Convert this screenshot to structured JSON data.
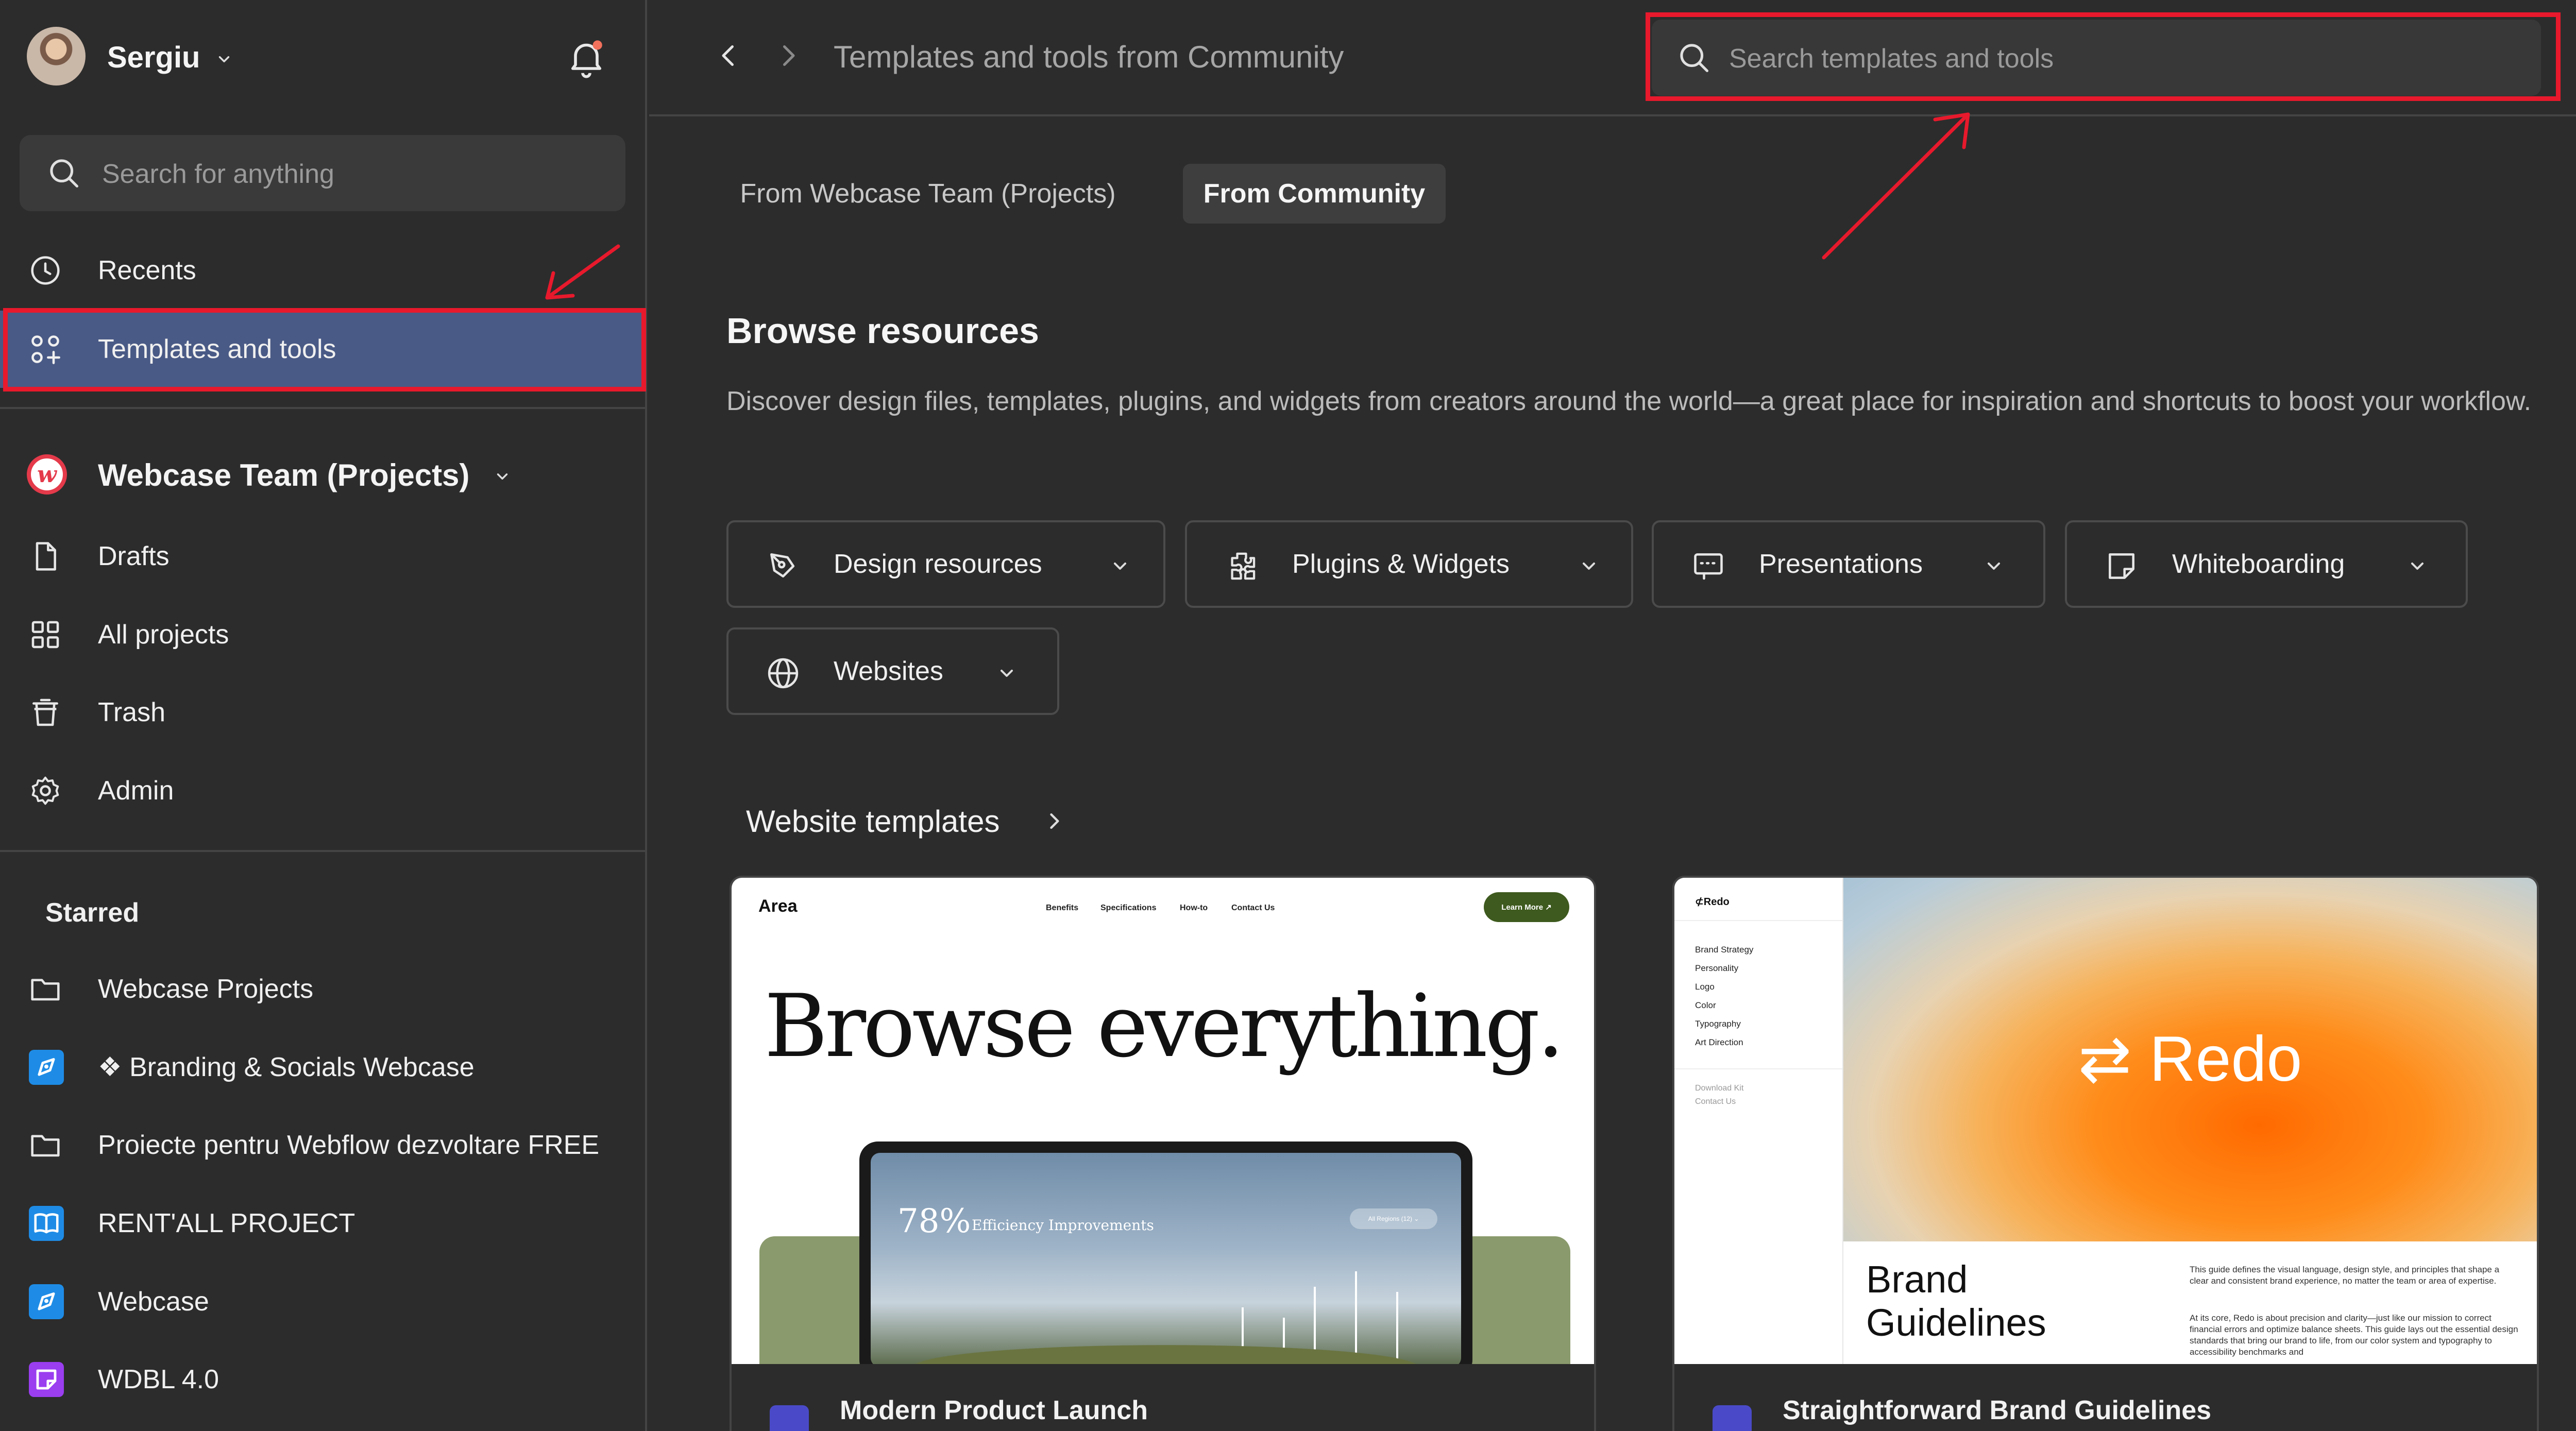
{
  "user": {
    "name": "Sergiu"
  },
  "sidebar": {
    "search_placeholder": "Search for anything",
    "nav": [
      {
        "label": "Recents",
        "icon": "clock-icon"
      },
      {
        "label": "Templates and tools",
        "icon": "templates-icon",
        "active": true
      }
    ],
    "team": {
      "name": "Webcase Team (Projects)"
    },
    "team_items": [
      {
        "label": "Drafts",
        "icon": "file-icon"
      },
      {
        "label": "All projects",
        "icon": "grid-icon"
      },
      {
        "label": "Trash",
        "icon": "trash-icon"
      },
      {
        "label": "Admin",
        "icon": "gear-icon"
      }
    ],
    "starred_heading": "Starred",
    "starred": [
      {
        "label": "Webcase Projects",
        "icon": "folder-icon"
      },
      {
        "label": "❖ Branding & Socials Webcase",
        "icon": "design-file-icon",
        "color": "#1e8ce6"
      },
      {
        "label": "Proiecte pentru Webflow dezvoltare FREE",
        "icon": "folder-icon"
      },
      {
        "label": "RENT'ALL PROJECT",
        "icon": "book-icon",
        "color": "#1e8ce6"
      },
      {
        "label": "Webcase",
        "icon": "design-file-icon",
        "color": "#1e8ce6"
      },
      {
        "label": "WDBL 4.0",
        "icon": "whiteboard-file-icon",
        "color": "#9a3ef0"
      }
    ]
  },
  "header": {
    "title": "Templates and tools from Community",
    "search_placeholder": "Search templates and tools"
  },
  "tabs": [
    {
      "label": "From Webcase Team (Projects)",
      "active": false
    },
    {
      "label": "From Community",
      "active": true
    }
  ],
  "browse": {
    "title": "Browse resources",
    "description": "Discover design files, templates, plugins, and widgets from creators around the world—a great place for inspiration and shortcuts to boost your workflow."
  },
  "categories": [
    {
      "label": "Design resources",
      "icon": "pen-icon"
    },
    {
      "label": "Plugins & Widgets",
      "icon": "plugin-icon"
    },
    {
      "label": "Presentations",
      "icon": "slides-icon"
    },
    {
      "label": "Whiteboarding",
      "icon": "sticky-note-icon"
    },
    {
      "label": "Websites",
      "icon": "globe-icon"
    }
  ],
  "section": {
    "title": "Website templates"
  },
  "cards": [
    {
      "title": "Modern Product Launch",
      "preview": {
        "logo": "Area",
        "nav": [
          "Benefits",
          "Specifications",
          "How-to",
          "Contact Us"
        ],
        "cta": "Learn More ↗",
        "headline": "Browse everything.",
        "stat": "78%",
        "stat_label": "Efficiency Improvements",
        "badge": "All Regions (12) ⌄"
      }
    },
    {
      "title": "Straightforward Brand Guidelines",
      "preview": {
        "logo": "⊄Redo",
        "menu": [
          "Brand Strategy",
          "Personality",
          "Logo",
          "Color",
          "Typography",
          "Art Direction"
        ],
        "links": [
          "Download Kit",
          "Contact Us"
        ],
        "hero": "⇄ Redo",
        "heading": "Brand Guidelines",
        "body1": "This guide defines the visual language, design style, and principles that shape a clear and consistent brand experience, no matter the team or area of expertise.",
        "body2": "At its core, Redo is about precision and clarity—just like our mission to correct financial errors and optimize balance sheets. This guide lays out the essential design standards that bring our brand to life, from our color system and typography to accessibility benchmarks and"
      }
    }
  ],
  "colors": {
    "accent": "#4a5a86",
    "annotation": "#e8192c"
  }
}
